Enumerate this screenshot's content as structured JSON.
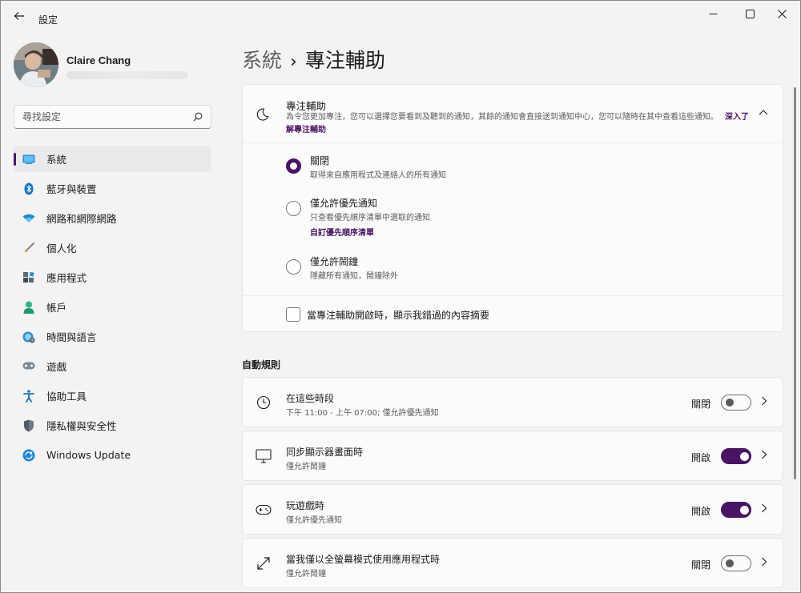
{
  "window": {
    "title": "設定",
    "controls": [
      "minimize-icon",
      "maximize-icon",
      "close-icon"
    ]
  },
  "profile": {
    "name": "Claire Chang"
  },
  "search": {
    "placeholder": "尋找設定"
  },
  "sidebar": {
    "items": [
      {
        "label": "系統",
        "icon": "system-display-icon",
        "active": true
      },
      {
        "label": "藍牙與裝置",
        "icon": "bluetooth-icon"
      },
      {
        "label": "網路和網際網路",
        "icon": "wifi-icon"
      },
      {
        "label": "個人化",
        "icon": "brush-icon"
      },
      {
        "label": "應用程式",
        "icon": "apps-icon"
      },
      {
        "label": "帳戶",
        "icon": "account-icon"
      },
      {
        "label": "時間與語言",
        "icon": "globe-clock-icon"
      },
      {
        "label": "遊戲",
        "icon": "gamepad-icon"
      },
      {
        "label": "協助工具",
        "icon": "accessibility-icon"
      },
      {
        "label": "隱私權與安全性",
        "icon": "shield-icon"
      },
      {
        "label": "Windows Update",
        "icon": "windows-update-icon"
      }
    ]
  },
  "breadcrumb": {
    "parent": "系統",
    "separator": "›",
    "current": "專注輔助"
  },
  "focus": {
    "title": "專注輔助",
    "description": "為令您更加專注，您可以選擇您要看到及聽到的通知，其餘的通知會直接送到通知中心，您可以隨時在其中查看這些通知。",
    "link": "深入了解專注輔助",
    "options": [
      {
        "label": "關閉",
        "desc": "取得來自應用程式及連絡人的所有通知",
        "checked": true
      },
      {
        "label": "僅允許優先通知",
        "desc": "只查看優先順序清單中選取的通知",
        "link": "自訂優先順序清單",
        "checked": false
      },
      {
        "label": "僅允許鬧鐘",
        "desc": "隱藏所有通知，鬧鐘除外",
        "checked": false
      }
    ],
    "summary_checkbox": {
      "label": "當專注輔助開啟時，顯示我錯過的內容摘要",
      "checked": false
    }
  },
  "auto_rules": {
    "title": "自動規則",
    "items": [
      {
        "title": "在這些時段",
        "sub": "下午 11:00 - 上午 07:00; 僅允許優先通知",
        "state": "關閉",
        "on": false,
        "icon": "clock-icon"
      },
      {
        "title": "同步顯示器畫面時",
        "sub": "僅允許鬧鐘",
        "state": "開啟",
        "on": true,
        "icon": "monitor-icon"
      },
      {
        "title": "玩遊戲時",
        "sub": "僅允許優先通知",
        "state": "開啟",
        "on": true,
        "icon": "gamepad-icon"
      },
      {
        "title": "當我僅以全螢幕模式使用應用程式時",
        "sub": "僅允許鬧鐘",
        "state": "關閉",
        "on": false,
        "icon": "fullscreen-icon"
      }
    ]
  },
  "colors": {
    "accent": "#4a1464",
    "background": "#f3f3f3",
    "card": "#fbfbfb"
  }
}
